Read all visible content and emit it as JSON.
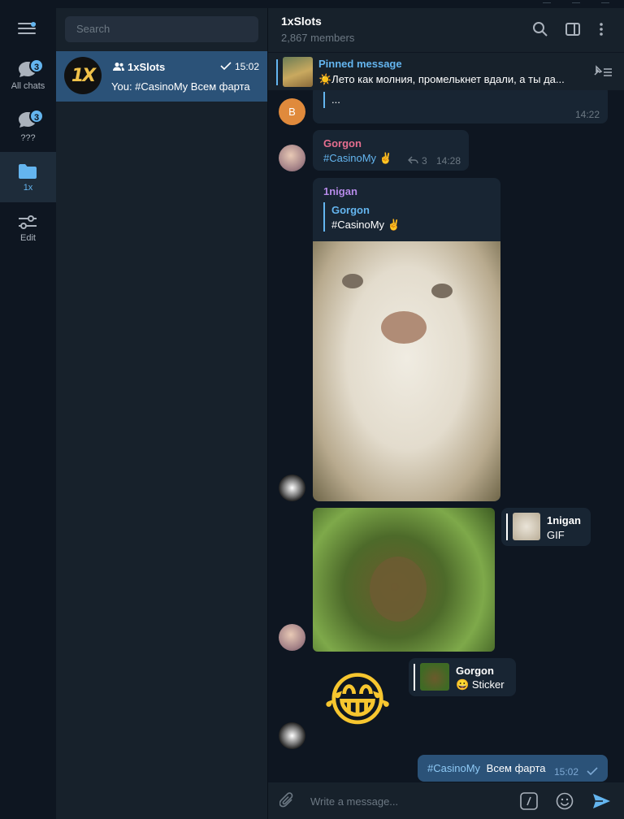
{
  "sidebar": {
    "folders": [
      {
        "label": "All chats",
        "badge": "3"
      },
      {
        "label": "???",
        "badge": "3"
      },
      {
        "label": "1x",
        "badge": ""
      },
      {
        "label": "Edit",
        "badge": ""
      }
    ]
  },
  "chatlist": {
    "search_placeholder": "Search",
    "chats": [
      {
        "avatar_text": "1X",
        "name": "1xSlots",
        "time": "15:02",
        "preview": "You: #CasinoMy  Всем фарта"
      }
    ]
  },
  "header": {
    "title": "1xSlots",
    "subtitle": "2,867 members"
  },
  "pinned": {
    "title": "Pinned message",
    "text": "☀️Лето как молния, промелькнет вдали, а ты да..."
  },
  "messages": {
    "m0": {
      "avatar_letter": "B",
      "text": "...",
      "time": "14:22"
    },
    "m1": {
      "sender": "Gorgon",
      "hashtag": "#CasinoMy",
      "emoji": "✌",
      "replies": "3",
      "time": "14:28"
    },
    "m2": {
      "sender": "1nigan",
      "reply_name": "Gorgon",
      "reply_hashtag": "#CasinoMy",
      "reply_emoji": "✌"
    },
    "m3": {
      "reply_name": "1nigan",
      "reply_text": "GIF"
    },
    "m4": {
      "reply_name": "Gorgon",
      "reply_emoji": "😀",
      "reply_text": "Sticker",
      "sticker": "😂"
    },
    "m5": {
      "hashtag": "#CasinoMy",
      "text": "Всем фарта",
      "time": "15:02"
    }
  },
  "input": {
    "placeholder": "Write a message..."
  },
  "colors": {
    "accent": "#64b5ef",
    "gorgon_name": "#e56e8f",
    "nigan_name": "#b68ae8",
    "own_bubble": "#2b5278"
  }
}
